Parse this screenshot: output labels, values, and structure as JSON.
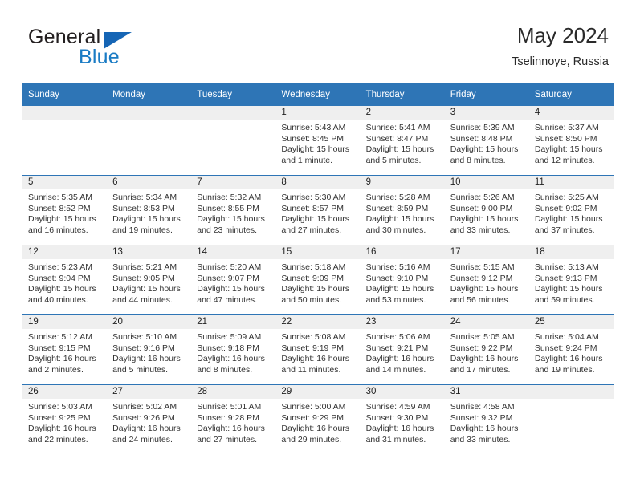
{
  "brand": {
    "name_top": "General",
    "name_bottom": "Blue",
    "triangle_color": "#1565b5",
    "blue_color": "#1a7bc4"
  },
  "header": {
    "month_title": "May 2024",
    "location": "Tselinnoye, Russia"
  },
  "colors": {
    "header_blue": "#2e75b6",
    "date_strip_gray": "#efefef",
    "text": "#333333"
  },
  "calendar": {
    "weekday_headers": [
      "Sunday",
      "Monday",
      "Tuesday",
      "Wednesday",
      "Thursday",
      "Friday",
      "Saturday"
    ],
    "labels": {
      "sunrise": "Sunrise:",
      "sunset": "Sunset:",
      "daylight": "Daylight:"
    },
    "weeks": [
      [
        {
          "date": ""
        },
        {
          "date": ""
        },
        {
          "date": ""
        },
        {
          "date": "1",
          "sunrise": "Sunrise: 5:43 AM",
          "sunset": "Sunset: 8:45 PM",
          "daylight_line1": "Daylight: 15 hours",
          "daylight_line2": "and 1 minute."
        },
        {
          "date": "2",
          "sunrise": "Sunrise: 5:41 AM",
          "sunset": "Sunset: 8:47 PM",
          "daylight_line1": "Daylight: 15 hours",
          "daylight_line2": "and 5 minutes."
        },
        {
          "date": "3",
          "sunrise": "Sunrise: 5:39 AM",
          "sunset": "Sunset: 8:48 PM",
          "daylight_line1": "Daylight: 15 hours",
          "daylight_line2": "and 8 minutes."
        },
        {
          "date": "4",
          "sunrise": "Sunrise: 5:37 AM",
          "sunset": "Sunset: 8:50 PM",
          "daylight_line1": "Daylight: 15 hours",
          "daylight_line2": "and 12 minutes."
        }
      ],
      [
        {
          "date": "5",
          "sunrise": "Sunrise: 5:35 AM",
          "sunset": "Sunset: 8:52 PM",
          "daylight_line1": "Daylight: 15 hours",
          "daylight_line2": "and 16 minutes."
        },
        {
          "date": "6",
          "sunrise": "Sunrise: 5:34 AM",
          "sunset": "Sunset: 8:53 PM",
          "daylight_line1": "Daylight: 15 hours",
          "daylight_line2": "and 19 minutes."
        },
        {
          "date": "7",
          "sunrise": "Sunrise: 5:32 AM",
          "sunset": "Sunset: 8:55 PM",
          "daylight_line1": "Daylight: 15 hours",
          "daylight_line2": "and 23 minutes."
        },
        {
          "date": "8",
          "sunrise": "Sunrise: 5:30 AM",
          "sunset": "Sunset: 8:57 PM",
          "daylight_line1": "Daylight: 15 hours",
          "daylight_line2": "and 27 minutes."
        },
        {
          "date": "9",
          "sunrise": "Sunrise: 5:28 AM",
          "sunset": "Sunset: 8:59 PM",
          "daylight_line1": "Daylight: 15 hours",
          "daylight_line2": "and 30 minutes."
        },
        {
          "date": "10",
          "sunrise": "Sunrise: 5:26 AM",
          "sunset": "Sunset: 9:00 PM",
          "daylight_line1": "Daylight: 15 hours",
          "daylight_line2": "and 33 minutes."
        },
        {
          "date": "11",
          "sunrise": "Sunrise: 5:25 AM",
          "sunset": "Sunset: 9:02 PM",
          "daylight_line1": "Daylight: 15 hours",
          "daylight_line2": "and 37 minutes."
        }
      ],
      [
        {
          "date": "12",
          "sunrise": "Sunrise: 5:23 AM",
          "sunset": "Sunset: 9:04 PM",
          "daylight_line1": "Daylight: 15 hours",
          "daylight_line2": "and 40 minutes."
        },
        {
          "date": "13",
          "sunrise": "Sunrise: 5:21 AM",
          "sunset": "Sunset: 9:05 PM",
          "daylight_line1": "Daylight: 15 hours",
          "daylight_line2": "and 44 minutes."
        },
        {
          "date": "14",
          "sunrise": "Sunrise: 5:20 AM",
          "sunset": "Sunset: 9:07 PM",
          "daylight_line1": "Daylight: 15 hours",
          "daylight_line2": "and 47 minutes."
        },
        {
          "date": "15",
          "sunrise": "Sunrise: 5:18 AM",
          "sunset": "Sunset: 9:09 PM",
          "daylight_line1": "Daylight: 15 hours",
          "daylight_line2": "and 50 minutes."
        },
        {
          "date": "16",
          "sunrise": "Sunrise: 5:16 AM",
          "sunset": "Sunset: 9:10 PM",
          "daylight_line1": "Daylight: 15 hours",
          "daylight_line2": "and 53 minutes."
        },
        {
          "date": "17",
          "sunrise": "Sunrise: 5:15 AM",
          "sunset": "Sunset: 9:12 PM",
          "daylight_line1": "Daylight: 15 hours",
          "daylight_line2": "and 56 minutes."
        },
        {
          "date": "18",
          "sunrise": "Sunrise: 5:13 AM",
          "sunset": "Sunset: 9:13 PM",
          "daylight_line1": "Daylight: 15 hours",
          "daylight_line2": "and 59 minutes."
        }
      ],
      [
        {
          "date": "19",
          "sunrise": "Sunrise: 5:12 AM",
          "sunset": "Sunset: 9:15 PM",
          "daylight_line1": "Daylight: 16 hours",
          "daylight_line2": "and 2 minutes."
        },
        {
          "date": "20",
          "sunrise": "Sunrise: 5:10 AM",
          "sunset": "Sunset: 9:16 PM",
          "daylight_line1": "Daylight: 16 hours",
          "daylight_line2": "and 5 minutes."
        },
        {
          "date": "21",
          "sunrise": "Sunrise: 5:09 AM",
          "sunset": "Sunset: 9:18 PM",
          "daylight_line1": "Daylight: 16 hours",
          "daylight_line2": "and 8 minutes."
        },
        {
          "date": "22",
          "sunrise": "Sunrise: 5:08 AM",
          "sunset": "Sunset: 9:19 PM",
          "daylight_line1": "Daylight: 16 hours",
          "daylight_line2": "and 11 minutes."
        },
        {
          "date": "23",
          "sunrise": "Sunrise: 5:06 AM",
          "sunset": "Sunset: 9:21 PM",
          "daylight_line1": "Daylight: 16 hours",
          "daylight_line2": "and 14 minutes."
        },
        {
          "date": "24",
          "sunrise": "Sunrise: 5:05 AM",
          "sunset": "Sunset: 9:22 PM",
          "daylight_line1": "Daylight: 16 hours",
          "daylight_line2": "and 17 minutes."
        },
        {
          "date": "25",
          "sunrise": "Sunrise: 5:04 AM",
          "sunset": "Sunset: 9:24 PM",
          "daylight_line1": "Daylight: 16 hours",
          "daylight_line2": "and 19 minutes."
        }
      ],
      [
        {
          "date": "26",
          "sunrise": "Sunrise: 5:03 AM",
          "sunset": "Sunset: 9:25 PM",
          "daylight_line1": "Daylight: 16 hours",
          "daylight_line2": "and 22 minutes."
        },
        {
          "date": "27",
          "sunrise": "Sunrise: 5:02 AM",
          "sunset": "Sunset: 9:26 PM",
          "daylight_line1": "Daylight: 16 hours",
          "daylight_line2": "and 24 minutes."
        },
        {
          "date": "28",
          "sunrise": "Sunrise: 5:01 AM",
          "sunset": "Sunset: 9:28 PM",
          "daylight_line1": "Daylight: 16 hours",
          "daylight_line2": "and 27 minutes."
        },
        {
          "date": "29",
          "sunrise": "Sunrise: 5:00 AM",
          "sunset": "Sunset: 9:29 PM",
          "daylight_line1": "Daylight: 16 hours",
          "daylight_line2": "and 29 minutes."
        },
        {
          "date": "30",
          "sunrise": "Sunrise: 4:59 AM",
          "sunset": "Sunset: 9:30 PM",
          "daylight_line1": "Daylight: 16 hours",
          "daylight_line2": "and 31 minutes."
        },
        {
          "date": "31",
          "sunrise": "Sunrise: 4:58 AM",
          "sunset": "Sunset: 9:32 PM",
          "daylight_line1": "Daylight: 16 hours",
          "daylight_line2": "and 33 minutes."
        },
        {
          "date": ""
        }
      ]
    ]
  }
}
